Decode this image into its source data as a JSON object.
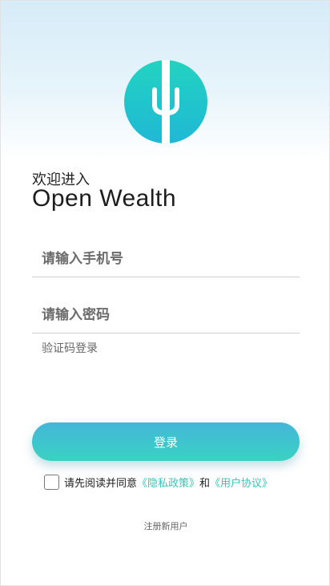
{
  "colors": {
    "accent": "#3bc3b8",
    "button_top": "#44b6d9",
    "button_bottom": "#39d2c2",
    "logo_top": "#22d3c0",
    "logo_bottom": "#1fb8d6"
  },
  "logo": {
    "icon": "fork-logo-icon"
  },
  "header": {
    "welcome": "欢迎进入",
    "app_name": "Open Wealth"
  },
  "form": {
    "phone_placeholder": "请输入手机号",
    "phone_value": "",
    "password_placeholder": "请输入密码",
    "password_value": "",
    "sms_login_label": "验证码登录",
    "login_button": "登录"
  },
  "agreement": {
    "checked": false,
    "prefix": "请先阅读并同意",
    "privacy_link": "《隐私政策》",
    "connector": "和",
    "terms_link": "《用户协议》"
  },
  "register_label": "注册新用户"
}
